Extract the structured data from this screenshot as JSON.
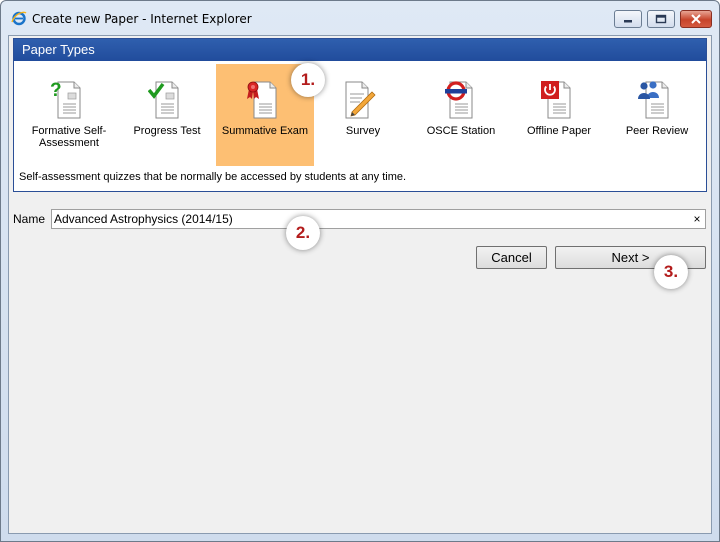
{
  "window": {
    "title": "Create new Paper - Internet Explorer",
    "icon": "internet-explorer-icon"
  },
  "paper_types": {
    "header": "Paper Types",
    "selected_index": 2,
    "items": [
      {
        "label": "Formative Self-Assessment",
        "icon": "question-doc-icon"
      },
      {
        "label": "Progress Test",
        "icon": "checkmark-doc-icon"
      },
      {
        "label": "Summative Exam",
        "icon": "rosette-doc-icon"
      },
      {
        "label": "Survey",
        "icon": "pencil-doc-icon"
      },
      {
        "label": "OSCE Station",
        "icon": "roundel-doc-icon"
      },
      {
        "label": "Offline Paper",
        "icon": "power-doc-icon"
      },
      {
        "label": "Peer Review",
        "icon": "people-doc-icon"
      }
    ],
    "description": "Self-assessment quizzes that be normally be accessed by students at any time."
  },
  "form": {
    "name_label": "Name",
    "name_value": "Advanced Astrophysics (2014/15)",
    "clear_glyph": "×"
  },
  "buttons": {
    "cancel": "Cancel",
    "next": "Next >"
  },
  "steps": [
    "1.",
    "2.",
    "3."
  ],
  "colors": {
    "header_bg": "#2f5fae",
    "selected_bg": "#fdbf73",
    "step_text": "#b31c1c"
  }
}
